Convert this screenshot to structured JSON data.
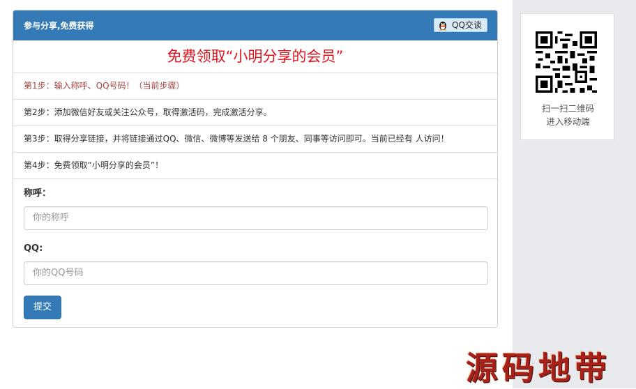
{
  "panel": {
    "title": "参与分享,免费获得",
    "qq_button": "QQ交谈",
    "headline": "免费领取“小明分享的会员”",
    "steps": [
      "第1步：输入称呼、QQ号码！（当前步骤）",
      "第2步：添加微信好友或关注公众号，取得激活码，完成激活分享。",
      "第3步：取得分享链接，并将链接通过QQ、微信、微博等发送给 8 个朋友、同事等访问即可。当前已经有 人访问！",
      "第4步：免费领取“小明分享的会员”！"
    ]
  },
  "form": {
    "name_label": "称呼：",
    "name_placeholder": "你的称呼",
    "qq_label": "QQ:",
    "qq_placeholder": "你的QQ号码",
    "submit_label": "提交"
  },
  "sidebar": {
    "qr_caption_line1": "扫一扫二维码",
    "qr_caption_line2": "进入移动端"
  },
  "watermark": "源码地带",
  "colors": {
    "primary": "#337ab7",
    "headline_red": "#e0141f",
    "active_step": "#a94442",
    "sidebar_bg": "#e9eaee"
  },
  "icons": [
    "qq-penguin-icon",
    "qr-code"
  ]
}
